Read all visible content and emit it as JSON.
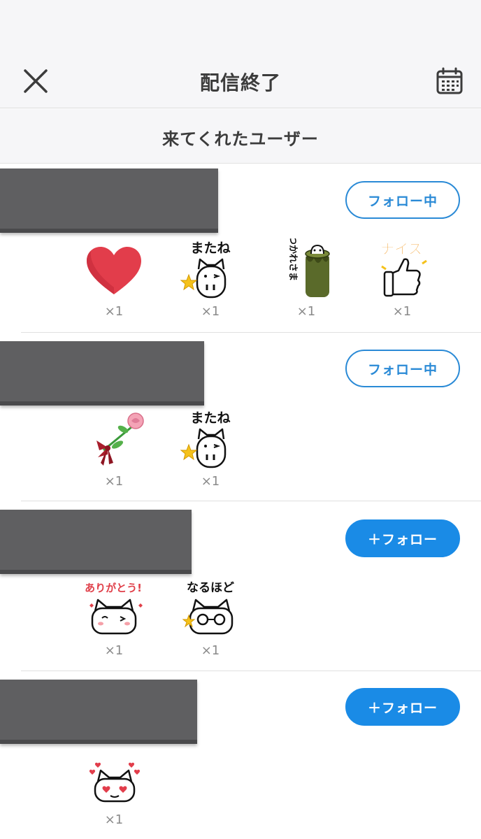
{
  "header": {
    "title": "配信終了",
    "close_icon": "close-icon",
    "calendar_icon": "calendar-icon"
  },
  "section": {
    "title": "来てくれたユーザー"
  },
  "colors": {
    "accent": "#1a8be6",
    "following_border": "#2a8ad6",
    "redaction": "#5f5f61",
    "background": "#f6f6f8"
  },
  "users": [
    {
      "follow_label": "フォロー中",
      "gifts": [
        {
          "name": "heart",
          "count": "×1"
        },
        {
          "name": "matane-cat",
          "caption": "またね",
          "count": "×1"
        },
        {
          "name": "otsukaresama-cat",
          "caption": "おつかれさま",
          "count": "×1"
        },
        {
          "name": "nice-thumbs-up",
          "caption": "ナイス",
          "count": "×1"
        }
      ]
    },
    {
      "follow_label": "フォロー中",
      "gifts": [
        {
          "name": "rose",
          "count": "×1"
        },
        {
          "name": "matane-cat",
          "caption": "またね",
          "count": "×1"
        }
      ]
    },
    {
      "follow_label": "＋フォロー",
      "gifts": [
        {
          "name": "arigatou-cat",
          "caption": "ありがとう!",
          "count": "×1"
        },
        {
          "name": "naruhodo-cat",
          "caption": "なるほど",
          "count": "×1"
        }
      ]
    },
    {
      "follow_label": "＋フォロー",
      "gifts": [
        {
          "name": "love-cat",
          "count": "×1"
        }
      ]
    }
  ]
}
